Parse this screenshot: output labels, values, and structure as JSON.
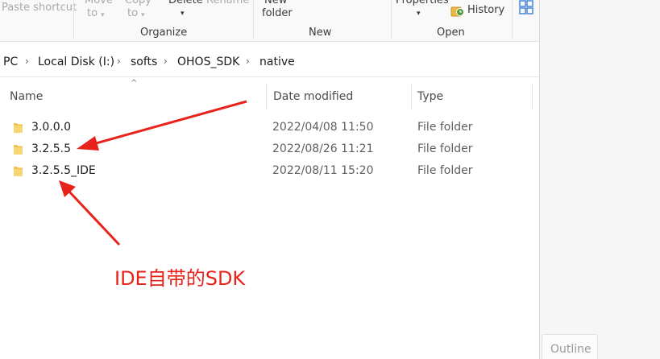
{
  "ribbon": {
    "paste_shortcut": "Paste shortcut",
    "move_to_top": "Move",
    "move_to_bottom": "to",
    "copy_to_top": "Copy",
    "copy_to_bottom": "to",
    "delete": "Delete",
    "rename": "Rename",
    "new_folder_top": "New",
    "new_folder_bottom": "folder",
    "properties": "Properties",
    "history": "History",
    "group_organize": "Organize",
    "group_new": "New",
    "group_open": "Open"
  },
  "address": {
    "crumbs": [
      "PC",
      "Local Disk (I:)",
      "softs",
      "OHOS_SDK",
      "native"
    ]
  },
  "columns": {
    "name": "Name",
    "date": "Date modified",
    "type": "Type"
  },
  "rows": [
    {
      "name": "3.0.0.0",
      "date": "2022/04/08 11:50",
      "type": "File folder"
    },
    {
      "name": "3.2.5.5",
      "date": "2022/08/26 11:21",
      "type": "File folder"
    },
    {
      "name": "3.2.5.5_IDE",
      "date": "2022/08/11 15:20",
      "type": "File folder"
    }
  ],
  "annotation": {
    "text": "IDE自带的SDK",
    "color": "#e8231c"
  },
  "right_pane": {
    "outline_tab": "Outline"
  },
  "icons": {
    "folder": "folder-icon",
    "history": "history-icon",
    "arrow": "annotation-arrow"
  }
}
